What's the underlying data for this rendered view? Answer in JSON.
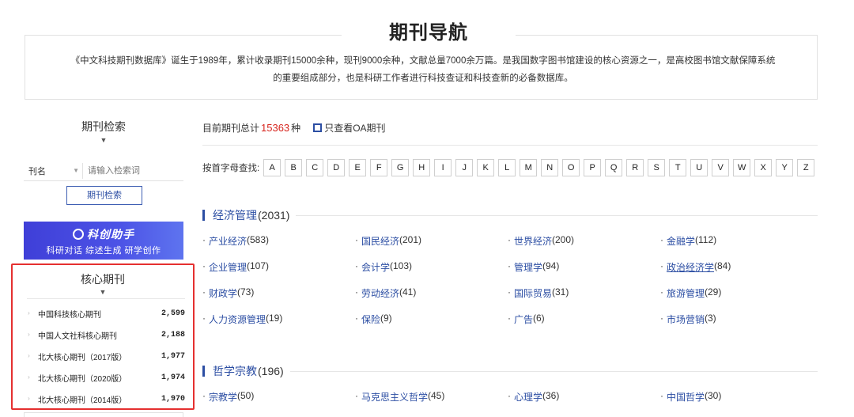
{
  "header": {
    "title": "期刊导航",
    "intro_line1": "《中文科技期刊数据库》诞生于1989年，累计收录期刊15000余种，现刊9000余种，文献总量7000余万篇。是我国数字图书馆建设的核心资源之一，是高校图书馆文献保障系统",
    "intro_line2": "的重要组成部分，也是科研工作者进行科技查证和科技查新的必备数据库。"
  },
  "search": {
    "title": "期刊检索",
    "field_label": "刊名",
    "placeholder": "请输入检索词",
    "button": "期刊检索"
  },
  "banner": {
    "title": "科创助手",
    "subtitle": "科研对话  综述生成  研学创作"
  },
  "core": {
    "title": "核心期刊",
    "items": [
      {
        "name": "中国科技核心期刊",
        "count": "2,599"
      },
      {
        "name": "中国人文社科核心期刊",
        "count": "2,188"
      },
      {
        "name": "北大核心期刊（2017版）",
        "count": "1,977"
      },
      {
        "name": "北大核心期刊（2020版）",
        "count": "1,974"
      },
      {
        "name": "北大核心期刊（2014版）",
        "count": "1,970"
      }
    ]
  },
  "summary": {
    "prefix": "目前期刊总计",
    "total": "15363",
    "suffix": "种",
    "oa_label": "只查看OA期刊"
  },
  "letters": {
    "label": "按首字母查找:",
    "items": [
      "A",
      "B",
      "C",
      "D",
      "E",
      "F",
      "G",
      "H",
      "I",
      "J",
      "K",
      "L",
      "M",
      "N",
      "O",
      "P",
      "Q",
      "R",
      "S",
      "T",
      "U",
      "V",
      "W",
      "X",
      "Y",
      "Z"
    ]
  },
  "categories": [
    {
      "name": "经济管理",
      "count": "(2031)",
      "subs": [
        {
          "name": "产业经济",
          "count": "(583)"
        },
        {
          "name": "国民经济",
          "count": "(201)"
        },
        {
          "name": "世界经济",
          "count": "(200)"
        },
        {
          "name": "金融学",
          "count": "(112)"
        },
        {
          "name": "企业管理",
          "count": "(107)"
        },
        {
          "name": "会计学",
          "count": "(103)"
        },
        {
          "name": "管理学",
          "count": "(94)"
        },
        {
          "name": "政治经济学",
          "count": "(84)"
        },
        {
          "name": "财政学",
          "count": "(73)"
        },
        {
          "name": "劳动经济",
          "count": "(41)"
        },
        {
          "name": "国际贸易",
          "count": "(31)"
        },
        {
          "name": "旅游管理",
          "count": "(29)"
        },
        {
          "name": "人力资源管理",
          "count": "(19)"
        },
        {
          "name": "保险",
          "count": "(9)"
        },
        {
          "name": "广告",
          "count": "(6)"
        },
        {
          "name": "市场营销",
          "count": "(3)"
        }
      ]
    },
    {
      "name": "哲学宗教",
      "count": "(196)",
      "subs": [
        {
          "name": "宗教学",
          "count": "(50)"
        },
        {
          "name": "马克思主义哲学",
          "count": "(45)"
        },
        {
          "name": "心理学",
          "count": "(36)"
        },
        {
          "name": "中国哲学",
          "count": "(30)"
        }
      ]
    }
  ],
  "colors": {
    "accent": "#2c4ea3",
    "total_red": "#d7261f",
    "highlight_border": "#e53030",
    "banner": "#4c53e6"
  }
}
